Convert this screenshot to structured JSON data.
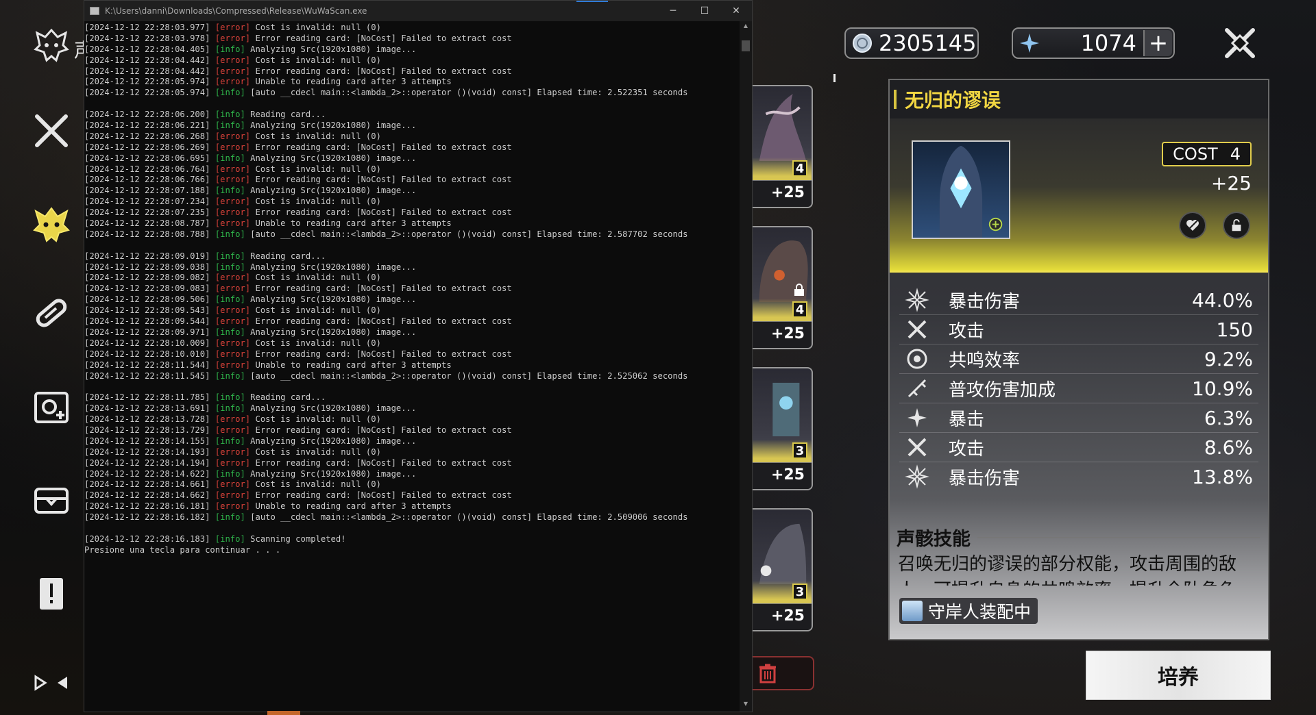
{
  "console": {
    "title": "K:\\Users\\danni\\Downloads\\Compressed\\Release\\WuWaScan.exe",
    "minimize": "─",
    "maximize": "☐",
    "close": "✕",
    "lines": [
      {
        "ts": "[2024-12-12 22:28:03.977] ",
        "tag": "[error]",
        "msg": " Cost is invalid: null (0)"
      },
      {
        "ts": "[2024-12-12 22:28:03.978] ",
        "tag": "[error]",
        "msg": " Error reading card: [NoCost] Failed to extract cost"
      },
      {
        "ts": "[2024-12-12 22:28:04.405] ",
        "tag": "[info]",
        "msg": " Analyzing Src(1920x1080) image..."
      },
      {
        "ts": "[2024-12-12 22:28:04.442] ",
        "tag": "[error]",
        "msg": " Cost is invalid: null (0)"
      },
      {
        "ts": "[2024-12-12 22:28:04.442] ",
        "tag": "[error]",
        "msg": " Error reading card: [NoCost] Failed to extract cost"
      },
      {
        "ts": "[2024-12-12 22:28:05.974] ",
        "tag": "[error]",
        "msg": " Unable to reading card after 3 attempts"
      },
      {
        "ts": "[2024-12-12 22:28:05.974] ",
        "tag": "[info]",
        "msg": " [auto __cdecl main::<lambda_2>::operator ()(void) const] Elapsed time: 2.522351 seconds"
      },
      {
        "ts": "",
        "tag": "",
        "msg": ""
      },
      {
        "ts": "[2024-12-12 22:28:06.200] ",
        "tag": "[info]",
        "msg": " Reading card..."
      },
      {
        "ts": "[2024-12-12 22:28:06.221] ",
        "tag": "[info]",
        "msg": " Analyzing Src(1920x1080) image..."
      },
      {
        "ts": "[2024-12-12 22:28:06.268] ",
        "tag": "[error]",
        "msg": " Cost is invalid: null (0)"
      },
      {
        "ts": "[2024-12-12 22:28:06.269] ",
        "tag": "[error]",
        "msg": " Error reading card: [NoCost] Failed to extract cost"
      },
      {
        "ts": "[2024-12-12 22:28:06.695] ",
        "tag": "[info]",
        "msg": " Analyzing Src(1920x1080) image..."
      },
      {
        "ts": "[2024-12-12 22:28:06.764] ",
        "tag": "[error]",
        "msg": " Cost is invalid: null (0)"
      },
      {
        "ts": "[2024-12-12 22:28:06.766] ",
        "tag": "[error]",
        "msg": " Error reading card: [NoCost] Failed to extract cost"
      },
      {
        "ts": "[2024-12-12 22:28:07.188] ",
        "tag": "[info]",
        "msg": " Analyzing Src(1920x1080) image..."
      },
      {
        "ts": "[2024-12-12 22:28:07.234] ",
        "tag": "[error]",
        "msg": " Cost is invalid: null (0)"
      },
      {
        "ts": "[2024-12-12 22:28:07.235] ",
        "tag": "[error]",
        "msg": " Error reading card: [NoCost] Failed to extract cost"
      },
      {
        "ts": "[2024-12-12 22:28:08.787] ",
        "tag": "[error]",
        "msg": " Unable to reading card after 3 attempts"
      },
      {
        "ts": "[2024-12-12 22:28:08.788] ",
        "tag": "[info]",
        "msg": " [auto __cdecl main::<lambda_2>::operator ()(void) const] Elapsed time: 2.587702 seconds"
      },
      {
        "ts": "",
        "tag": "",
        "msg": ""
      },
      {
        "ts": "[2024-12-12 22:28:09.019] ",
        "tag": "[info]",
        "msg": " Reading card..."
      },
      {
        "ts": "[2024-12-12 22:28:09.038] ",
        "tag": "[info]",
        "msg": " Analyzing Src(1920x1080) image..."
      },
      {
        "ts": "[2024-12-12 22:28:09.082] ",
        "tag": "[error]",
        "msg": " Cost is invalid: null (0)"
      },
      {
        "ts": "[2024-12-12 22:28:09.083] ",
        "tag": "[error]",
        "msg": " Error reading card: [NoCost] Failed to extract cost"
      },
      {
        "ts": "[2024-12-12 22:28:09.506] ",
        "tag": "[info]",
        "msg": " Analyzing Src(1920x1080) image..."
      },
      {
        "ts": "[2024-12-12 22:28:09.543] ",
        "tag": "[error]",
        "msg": " Cost is invalid: null (0)"
      },
      {
        "ts": "[2024-12-12 22:28:09.544] ",
        "tag": "[error]",
        "msg": " Error reading card: [NoCost] Failed to extract cost"
      },
      {
        "ts": "[2024-12-12 22:28:09.971] ",
        "tag": "[info]",
        "msg": " Analyzing Src(1920x1080) image..."
      },
      {
        "ts": "[2024-12-12 22:28:10.009] ",
        "tag": "[error]",
        "msg": " Cost is invalid: null (0)"
      },
      {
        "ts": "[2024-12-12 22:28:10.010] ",
        "tag": "[error]",
        "msg": " Error reading card: [NoCost] Failed to extract cost"
      },
      {
        "ts": "[2024-12-12 22:28:11.544] ",
        "tag": "[error]",
        "msg": " Unable to reading card after 3 attempts"
      },
      {
        "ts": "[2024-12-12 22:28:11.545] ",
        "tag": "[info]",
        "msg": " [auto __cdecl main::<lambda_2>::operator ()(void) const] Elapsed time: 2.525062 seconds"
      },
      {
        "ts": "",
        "tag": "",
        "msg": ""
      },
      {
        "ts": "[2024-12-12 22:28:11.785] ",
        "tag": "[info]",
        "msg": " Reading card..."
      },
      {
        "ts": "[2024-12-12 22:28:13.691] ",
        "tag": "[info]",
        "msg": " Analyzing Src(1920x1080) image..."
      },
      {
        "ts": "[2024-12-12 22:28:13.728] ",
        "tag": "[error]",
        "msg": " Cost is invalid: null (0)"
      },
      {
        "ts": "[2024-12-12 22:28:13.729] ",
        "tag": "[error]",
        "msg": " Error reading card: [NoCost] Failed to extract cost"
      },
      {
        "ts": "[2024-12-12 22:28:14.155] ",
        "tag": "[info]",
        "msg": " Analyzing Src(1920x1080) image..."
      },
      {
        "ts": "[2024-12-12 22:28:14.193] ",
        "tag": "[error]",
        "msg": " Cost is invalid: null (0)"
      },
      {
        "ts": "[2024-12-12 22:28:14.194] ",
        "tag": "[error]",
        "msg": " Error reading card: [NoCost] Failed to extract cost"
      },
      {
        "ts": "[2024-12-12 22:28:14.622] ",
        "tag": "[info]",
        "msg": " Analyzing Src(1920x1080) image..."
      },
      {
        "ts": "[2024-12-12 22:28:14.661] ",
        "tag": "[error]",
        "msg": " Cost is invalid: null (0)"
      },
      {
        "ts": "[2024-12-12 22:28:14.662] ",
        "tag": "[error]",
        "msg": " Error reading card: [NoCost] Failed to extract cost"
      },
      {
        "ts": "[2024-12-12 22:28:16.181] ",
        "tag": "[error]",
        "msg": " Unable to reading card after 3 attempts"
      },
      {
        "ts": "[2024-12-12 22:28:16.182] ",
        "tag": "[info]",
        "msg": " [auto __cdecl main::<lambda_2>::operator ()(void) const] Elapsed time: 2.509006 seconds"
      },
      {
        "ts": "",
        "tag": "",
        "msg": ""
      },
      {
        "ts": "[2024-12-12 22:28:16.183] ",
        "tag": "[info]",
        "msg": " Scanning completed!"
      },
      {
        "ts": "",
        "tag": "",
        "msg": "Presione una tecla para continuar . . ."
      }
    ]
  },
  "sidebar": {
    "label_partial": "声",
    "items": [
      {
        "name": "echo-data-bank-icon"
      },
      {
        "name": "weapon-icon"
      },
      {
        "name": "echo-icon"
      },
      {
        "name": "supply-icon"
      },
      {
        "name": "resonator-icon"
      },
      {
        "name": "item-box-icon"
      },
      {
        "name": "quest-item-icon"
      },
      {
        "name": "sort-icon"
      }
    ]
  },
  "currency": {
    "shell_credit": "2305145",
    "astrite": "1074",
    "plus": "+"
  },
  "cards": [
    {
      "cost": "4",
      "level": "+25",
      "locked": false
    },
    {
      "cost": "4",
      "level": "+25",
      "locked": true
    },
    {
      "cost": "3",
      "level": "+25",
      "locked": false
    },
    {
      "cost": "3",
      "level": "+25",
      "locked": false
    }
  ],
  "detail": {
    "title": "无归的谬误",
    "cost_label": "COST",
    "cost_value": "4",
    "level": "+25",
    "stats": [
      {
        "icon": "crit-dmg-icon",
        "name": "暴击伤害",
        "value": "44.0%"
      },
      {
        "icon": "atk-icon",
        "name": "攻击",
        "value": "150"
      },
      {
        "icon": "energy-regen-icon",
        "name": "共鸣效率",
        "value": "9.2%"
      },
      {
        "icon": "basic-atk-dmg-icon",
        "name": "普攻伤害加成",
        "value": "10.9%"
      },
      {
        "icon": "crit-rate-icon",
        "name": "暴击",
        "value": "6.3%"
      },
      {
        "icon": "atk-icon",
        "name": "攻击",
        "value": "8.6%"
      },
      {
        "icon": "crit-dmg-icon",
        "name": "暴击伤害",
        "value": "13.8%"
      }
    ],
    "skill_title": "声骸技能",
    "skill_desc": "召唤无归的谬误的部分权能，攻击周围的敌人，可提升自身的共鸣效率，提升全队角色",
    "equipped_label": "守岸人装配中"
  },
  "cultivate_label": "培养",
  "colors": {
    "accent_gold": "#f1d642",
    "error_red": "#d9423a",
    "info_green": "#2fb64b"
  }
}
